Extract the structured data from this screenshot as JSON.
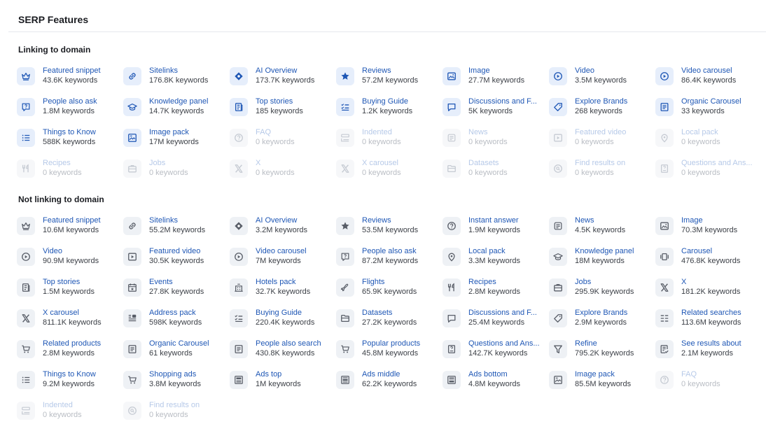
{
  "title": "SERP Features",
  "colors": {
    "link": "#1f57b5",
    "link_disabled": "#b6c9e8",
    "icon_bg": "#eef1f5",
    "icon_active_bg": "#e6eefb"
  },
  "sections": [
    {
      "id": "linking",
      "title": "Linking to domain",
      "items": [
        {
          "label": "Featured snippet",
          "count": "43.6K keywords",
          "icon": "crown-icon",
          "state": "active"
        },
        {
          "label": "Sitelinks",
          "count": "176.8K keywords",
          "icon": "link-icon",
          "state": "active"
        },
        {
          "label": "AI Overview",
          "count": "173.7K keywords",
          "icon": "diamond-icon",
          "state": "active"
        },
        {
          "label": "Reviews",
          "count": "57.2M keywords",
          "icon": "star-icon",
          "state": "active"
        },
        {
          "label": "Image",
          "count": "27.7M keywords",
          "icon": "image-icon",
          "state": "active"
        },
        {
          "label": "Video",
          "count": "3.5M keywords",
          "icon": "play-circle-icon",
          "state": "active"
        },
        {
          "label": "Video carousel",
          "count": "86.4K keywords",
          "icon": "play-circle-icon",
          "state": "active"
        },
        {
          "label": "People also ask",
          "count": "1.8M keywords",
          "icon": "question-bubble-icon",
          "state": "active"
        },
        {
          "label": "Knowledge panel",
          "count": "14.7K keywords",
          "icon": "graduation-cap-icon",
          "state": "active"
        },
        {
          "label": "Top stories",
          "count": "185 keywords",
          "icon": "newspaper-icon",
          "state": "active"
        },
        {
          "label": "Buying Guide",
          "count": "1.2K keywords",
          "icon": "checklist-icon",
          "state": "active"
        },
        {
          "label": "Discussions and F...",
          "count": "5K keywords",
          "icon": "chat-bubble-icon",
          "state": "active"
        },
        {
          "label": "Explore Brands",
          "count": "268 keywords",
          "icon": "tag-icon",
          "state": "active"
        },
        {
          "label": "Organic Carousel",
          "count": "33 keywords",
          "icon": "document-list-icon",
          "state": "active"
        },
        {
          "label": "Things to Know",
          "count": "588K keywords",
          "icon": "bullet-list-icon",
          "state": "active"
        },
        {
          "label": "Image pack",
          "count": "17M keywords",
          "icon": "image-pack-icon",
          "state": "active"
        },
        {
          "label": "FAQ",
          "count": "0 keywords",
          "icon": "help-circle-icon",
          "state": "disabled"
        },
        {
          "label": "Indented",
          "count": "0 keywords",
          "icon": "indent-icon",
          "state": "disabled"
        },
        {
          "label": "News",
          "count": "0 keywords",
          "icon": "news-icon",
          "state": "disabled"
        },
        {
          "label": "Featured video",
          "count": "0 keywords",
          "icon": "play-square-icon",
          "state": "disabled"
        },
        {
          "label": "Local pack",
          "count": "0 keywords",
          "icon": "map-pin-icon",
          "state": "disabled"
        },
        {
          "label": "Recipes",
          "count": "0 keywords",
          "icon": "fork-knife-icon",
          "state": "disabled"
        },
        {
          "label": "Jobs",
          "count": "0 keywords",
          "icon": "briefcase-icon",
          "state": "disabled"
        },
        {
          "label": "X",
          "count": "0 keywords",
          "icon": "x-logo-icon",
          "state": "disabled"
        },
        {
          "label": "X carousel",
          "count": "0 keywords",
          "icon": "x-logo-icon",
          "state": "disabled"
        },
        {
          "label": "Datasets",
          "count": "0 keywords",
          "icon": "folder-icon",
          "state": "disabled"
        },
        {
          "label": "Find results on",
          "count": "0 keywords",
          "icon": "search-circle-icon",
          "state": "disabled"
        },
        {
          "label": "Questions and Ans...",
          "count": "0 keywords",
          "icon": "qa-document-icon",
          "state": "disabled"
        }
      ]
    },
    {
      "id": "notlinking",
      "title": "Not linking to domain",
      "items": [
        {
          "label": "Featured snippet",
          "count": "10.6M keywords",
          "icon": "crown-icon",
          "state": "muted"
        },
        {
          "label": "Sitelinks",
          "count": "55.2M keywords",
          "icon": "link-icon",
          "state": "muted"
        },
        {
          "label": "AI Overview",
          "count": "3.2M keywords",
          "icon": "diamond-icon",
          "state": "muted"
        },
        {
          "label": "Reviews",
          "count": "53.5M keywords",
          "icon": "star-icon",
          "state": "muted"
        },
        {
          "label": "Instant answer",
          "count": "1.9M keywords",
          "icon": "help-circle-icon",
          "state": "muted"
        },
        {
          "label": "News",
          "count": "4.5K keywords",
          "icon": "news-icon",
          "state": "muted"
        },
        {
          "label": "Image",
          "count": "70.3M keywords",
          "icon": "image-icon",
          "state": "muted"
        },
        {
          "label": "Video",
          "count": "90.9M keywords",
          "icon": "play-circle-icon",
          "state": "muted"
        },
        {
          "label": "Featured video",
          "count": "30.5K keywords",
          "icon": "play-square-icon",
          "state": "muted"
        },
        {
          "label": "Video carousel",
          "count": "7M keywords",
          "icon": "play-circle-icon",
          "state": "muted"
        },
        {
          "label": "People also ask",
          "count": "87.2M keywords",
          "icon": "question-bubble-icon",
          "state": "muted"
        },
        {
          "label": "Local pack",
          "count": "3.3M keywords",
          "icon": "map-pin-icon",
          "state": "muted"
        },
        {
          "label": "Knowledge panel",
          "count": "18M keywords",
          "icon": "graduation-cap-icon",
          "state": "muted"
        },
        {
          "label": "Carousel",
          "count": "476.8K keywords",
          "icon": "carousel-icon",
          "state": "muted"
        },
        {
          "label": "Top stories",
          "count": "1.5M keywords",
          "icon": "newspaper-icon",
          "state": "muted"
        },
        {
          "label": "Events",
          "count": "27.8K keywords",
          "icon": "calendar-icon",
          "state": "muted"
        },
        {
          "label": "Hotels pack",
          "count": "32.7K keywords",
          "icon": "hotel-icon",
          "state": "muted"
        },
        {
          "label": "Flights",
          "count": "65.9K keywords",
          "icon": "plane-icon",
          "state": "muted"
        },
        {
          "label": "Recipes",
          "count": "2.8M keywords",
          "icon": "fork-knife-icon",
          "state": "muted"
        },
        {
          "label": "Jobs",
          "count": "295.9K keywords",
          "icon": "briefcase-icon",
          "state": "muted"
        },
        {
          "label": "X",
          "count": "181.2K keywords",
          "icon": "x-logo-icon",
          "state": "muted"
        },
        {
          "label": "X carousel",
          "count": "811.1K keywords",
          "icon": "x-logo-icon",
          "state": "muted"
        },
        {
          "label": "Address pack",
          "count": "598K keywords",
          "icon": "address-icon",
          "state": "muted"
        },
        {
          "label": "Buying Guide",
          "count": "220.4K keywords",
          "icon": "checklist-icon",
          "state": "muted"
        },
        {
          "label": "Datasets",
          "count": "27.2K keywords",
          "icon": "folder-icon",
          "state": "muted"
        },
        {
          "label": "Discussions and F...",
          "count": "25.4M keywords",
          "icon": "chat-bubble-icon",
          "state": "muted"
        },
        {
          "label": "Explore Brands",
          "count": "2.9M keywords",
          "icon": "tag-icon",
          "state": "muted"
        },
        {
          "label": "Related searches",
          "count": "113.6M keywords",
          "icon": "lines-grid-icon",
          "state": "muted"
        },
        {
          "label": "Related products",
          "count": "2.8M keywords",
          "icon": "cart-icon",
          "state": "muted"
        },
        {
          "label": "Organic Carousel",
          "count": "61 keywords",
          "icon": "document-list-icon",
          "state": "muted"
        },
        {
          "label": "People also search",
          "count": "430.8K keywords",
          "icon": "document-list-icon",
          "state": "muted"
        },
        {
          "label": "Popular products",
          "count": "45.8M keywords",
          "icon": "cart-icon",
          "state": "muted"
        },
        {
          "label": "Questions and Ans...",
          "count": "142.7K keywords",
          "icon": "qa-document-icon",
          "state": "muted"
        },
        {
          "label": "Refine",
          "count": "795.2K keywords",
          "icon": "filter-icon",
          "state": "muted"
        },
        {
          "label": "See results about",
          "count": "2.1M keywords",
          "icon": "document-check-icon",
          "state": "muted"
        },
        {
          "label": "Things to Know",
          "count": "9.2M keywords",
          "icon": "bullet-list-icon",
          "state": "muted"
        },
        {
          "label": "Shopping ads",
          "count": "3.8M keywords",
          "icon": "cart-icon",
          "state": "muted"
        },
        {
          "label": "Ads top",
          "count": "1M keywords",
          "icon": "ad-top-icon",
          "state": "muted"
        },
        {
          "label": "Ads middle",
          "count": "62.2K keywords",
          "icon": "ad-middle-icon",
          "state": "muted"
        },
        {
          "label": "Ads bottom",
          "count": "4.8M keywords",
          "icon": "ad-bottom-icon",
          "state": "muted"
        },
        {
          "label": "Image pack",
          "count": "85.5M keywords",
          "icon": "image-pack-icon",
          "state": "muted"
        },
        {
          "label": "FAQ",
          "count": "0 keywords",
          "icon": "help-circle-icon",
          "state": "disabled"
        },
        {
          "label": "Indented",
          "count": "0 keywords",
          "icon": "indent-icon",
          "state": "disabled"
        },
        {
          "label": "Find results on",
          "count": "0 keywords",
          "icon": "search-circle-icon",
          "state": "disabled"
        }
      ]
    }
  ]
}
